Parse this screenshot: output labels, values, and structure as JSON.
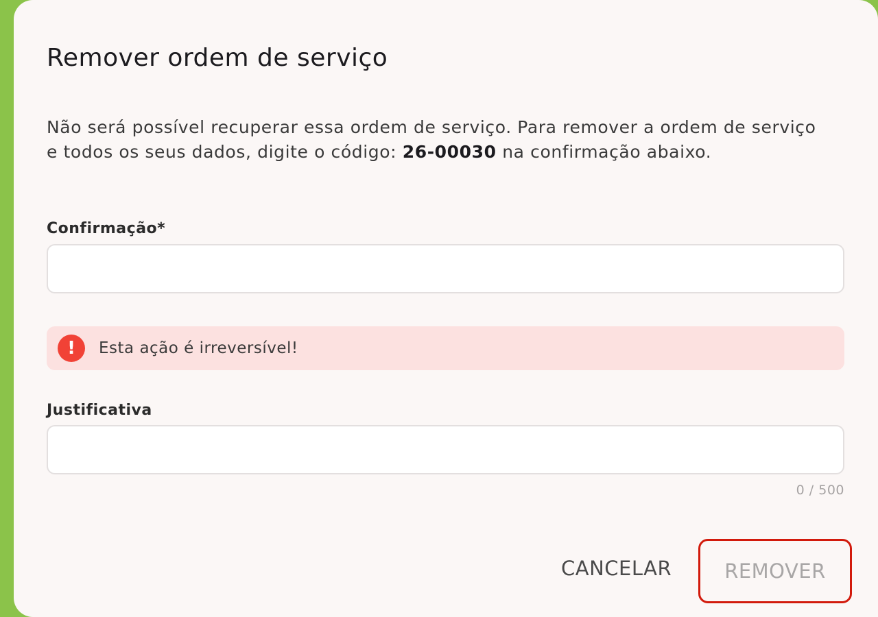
{
  "dialog": {
    "title": "Remover ordem de serviço",
    "message_before": "Não será possível recuperar essa ordem de serviço. Para remover a ordem de serviço e todos os seus dados, digite o código: ",
    "code": "26-00030",
    "message_after": " na confirmação abaixo."
  },
  "confirmation": {
    "label": "Confirmação*",
    "value": ""
  },
  "alert": {
    "icon": "exclamation-icon",
    "glyph": "!",
    "text": "Esta ação é irreversível!"
  },
  "justification": {
    "label": "Justificativa",
    "value": "",
    "counter": "0 / 500"
  },
  "actions": {
    "cancel_label": "CANCELAR",
    "remove_label": "REMOVER"
  },
  "colors": {
    "side_accent": "#8bc34a",
    "alert_bg": "#fce1e0",
    "alert_icon": "#f14236",
    "remove_outline": "#d21a0c"
  }
}
